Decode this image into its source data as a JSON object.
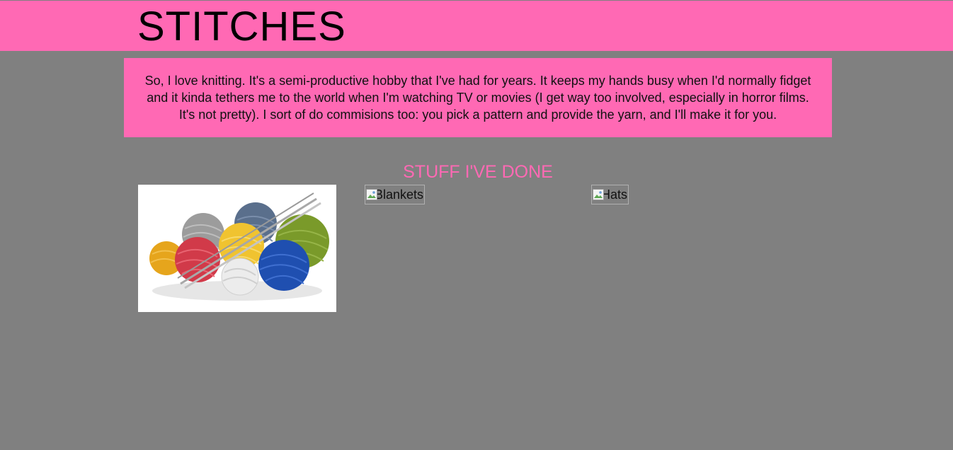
{
  "header": {
    "title": "STITCHES"
  },
  "intro": {
    "text": "So, I love knitting. It's a semi-productive hobby that I've had for years. It keeps my hands busy when I'd normally fidget and it kinda tethers me to the world when I'm watching TV or movies (I get way too involved, especially in horror films. It's not pretty). I sort of do commisions too: you pick a pattern and provide the yarn, and I'll make it for you."
  },
  "gallery": {
    "heading": "STUFF I'VE DONE",
    "items": [
      {
        "alt": "",
        "kind": "photo",
        "subject": "yarn balls with knitting needles"
      },
      {
        "alt": "Blankets",
        "kind": "broken-image"
      },
      {
        "alt": "Hats",
        "kind": "broken-image"
      }
    ]
  },
  "colors": {
    "accent_pink": "#ff69b4",
    "page_background": "#808080",
    "text_dark": "#000000"
  }
}
